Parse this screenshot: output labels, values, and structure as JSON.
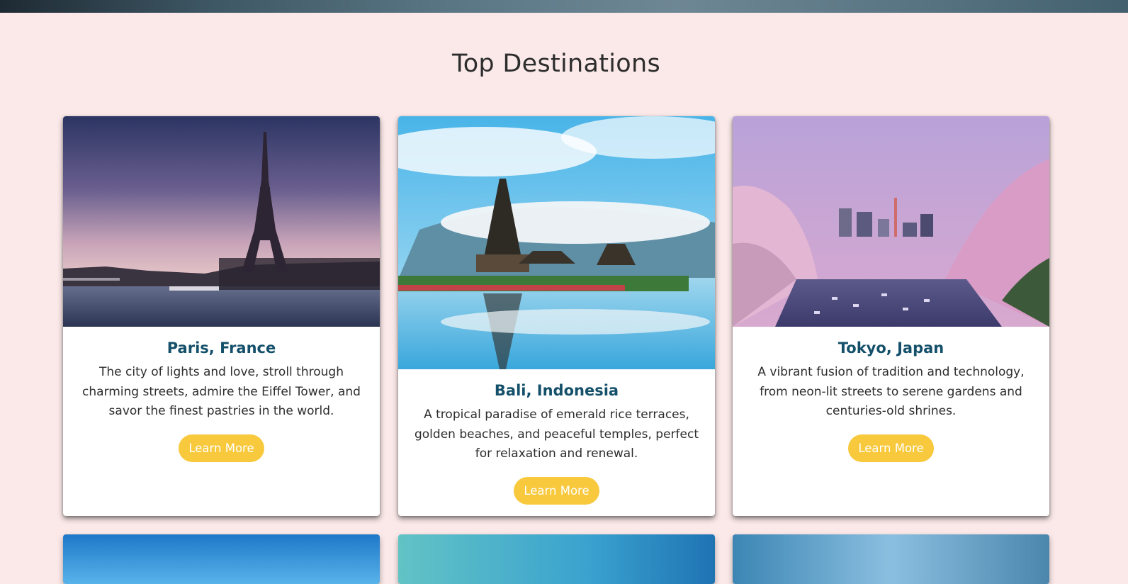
{
  "section": {
    "title": "Top Destinations"
  },
  "destinations": [
    {
      "title": "Paris, France",
      "description": "The city of lights and love, stroll through charming streets, admire the Eiffel Tower, and savor the finest pastries in the world.",
      "button_label": "Learn More",
      "image_icon": "eiffel-tower-photo"
    },
    {
      "title": "Bali, Indonesia",
      "description": "A tropical paradise of emerald rice terraces, golden beaches, and peaceful temples, perfect for relaxation and renewal.",
      "button_label": "Learn More",
      "image_icon": "bali-temple-photo"
    },
    {
      "title": "Tokyo, Japan",
      "description": "A vibrant fusion of tradition and technology, from neon-lit streets to serene gardens and centuries-old shrines.",
      "button_label": "Learn More",
      "image_icon": "tokyo-cherry-blossom-photo"
    }
  ],
  "colors": {
    "page_background": "#fbe9e9",
    "title_accent": "#14506a",
    "button": "#f8c93d"
  }
}
